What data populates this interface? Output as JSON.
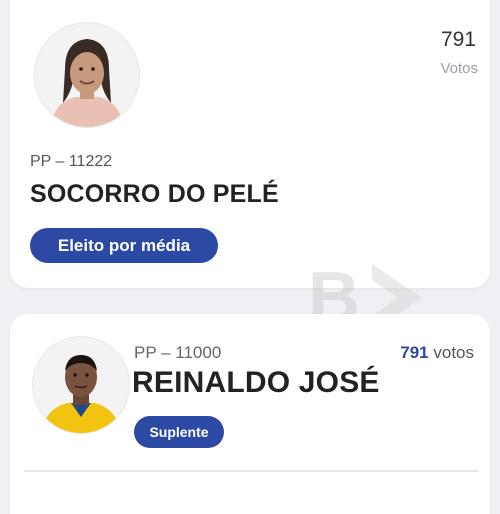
{
  "candidates": [
    {
      "party_number": "PP – 11222",
      "name": "SOCORRO DO PELÉ",
      "votes": "791",
      "votes_label": "Votos",
      "status": "Eleito por média",
      "avatar_icon": "candidate-photo-socorro"
    },
    {
      "party_number": "PP – 11000",
      "name": "REINALDO JOSÉ",
      "votes": "791",
      "votes_label": "votos",
      "status": "Suplente",
      "avatar_icon": "candidate-photo-reinaldo"
    }
  ],
  "watermark": {
    "letter": "B",
    "icon": "brand-watermark-play-icon"
  },
  "colors": {
    "accent": "#2c4aa3",
    "background": "#eef0f3",
    "card": "#ffffff"
  }
}
